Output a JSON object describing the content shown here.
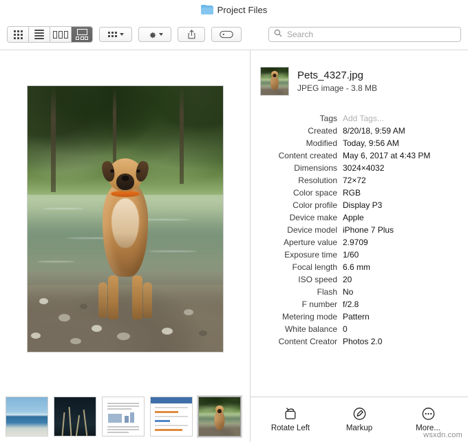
{
  "window": {
    "title": "Project Files",
    "folder_icon": "folder-icon"
  },
  "toolbar": {
    "view_modes": [
      {
        "name": "icon-view",
        "icon": "grid-icon",
        "active": false
      },
      {
        "name": "list-view",
        "icon": "list-icon",
        "active": false
      },
      {
        "name": "column-view",
        "icon": "columns-icon",
        "active": false
      },
      {
        "name": "gallery-view",
        "icon": "gallery-icon",
        "active": true
      }
    ],
    "group_by": {
      "name": "group-by-button",
      "icon": "group-icon",
      "caret": "chevron-down-icon"
    },
    "action_menu": {
      "name": "action-menu-button",
      "icon": "gear-icon",
      "caret": "chevron-down-icon"
    },
    "share": {
      "name": "share-button",
      "icon": "share-icon"
    },
    "tags": {
      "name": "tags-button",
      "icon": "tag-icon"
    },
    "search": {
      "icon": "search-icon",
      "placeholder": "Search",
      "value": ""
    }
  },
  "preview": {
    "image_alt": "dog-standing-in-river-photo"
  },
  "thumbnails": [
    {
      "name": "thumbnail-beach",
      "label": "beach photo",
      "selected": false
    },
    {
      "name": "thumbnail-night-plants",
      "label": "dark plants photo",
      "selected": false
    },
    {
      "name": "thumbnail-document",
      "label": "text document",
      "selected": false
    },
    {
      "name": "thumbnail-spreadsheet",
      "label": "spreadsheet",
      "selected": false
    },
    {
      "name": "thumbnail-dog",
      "label": "Pets_4327.jpg",
      "selected": true
    }
  ],
  "file": {
    "name": "Pets_4327.jpg",
    "kind_and_size": "JPEG image - 3.8 MB"
  },
  "info": [
    {
      "label": "Tags",
      "value": "Add Tags...",
      "placeholder": true
    },
    {
      "label": "Created",
      "value": "8/20/18, 9:59 AM",
      "placeholder": false
    },
    {
      "label": "Modified",
      "value": "Today, 9:56 AM",
      "placeholder": false
    },
    {
      "label": "Content created",
      "value": "May 6, 2017 at 4:43 PM",
      "placeholder": false
    },
    {
      "label": "Dimensions",
      "value": "3024×4032",
      "placeholder": false
    },
    {
      "label": "Resolution",
      "value": "72×72",
      "placeholder": false
    },
    {
      "label": "Color space",
      "value": "RGB",
      "placeholder": false
    },
    {
      "label": "Color profile",
      "value": "Display P3",
      "placeholder": false
    },
    {
      "label": "Device make",
      "value": "Apple",
      "placeholder": false
    },
    {
      "label": "Device model",
      "value": "iPhone 7 Plus",
      "placeholder": false
    },
    {
      "label": "Aperture value",
      "value": "2.9709",
      "placeholder": false
    },
    {
      "label": "Exposure time",
      "value": "1/60",
      "placeholder": false
    },
    {
      "label": "Focal length",
      "value": "6.6 mm",
      "placeholder": false
    },
    {
      "label": "ISO speed",
      "value": "20",
      "placeholder": false
    },
    {
      "label": "Flash",
      "value": "No",
      "placeholder": false
    },
    {
      "label": "F number",
      "value": "f/2.8",
      "placeholder": false
    },
    {
      "label": "Metering mode",
      "value": "Pattern",
      "placeholder": false
    },
    {
      "label": "White balance",
      "value": "0",
      "placeholder": false
    },
    {
      "label": "Content Creator",
      "value": "Photos 2.0",
      "placeholder": false
    }
  ],
  "actions": [
    {
      "name": "rotate-left-action",
      "label": "Rotate Left",
      "icon": "rotate-left-icon"
    },
    {
      "name": "markup-action",
      "label": "Markup",
      "icon": "markup-icon"
    },
    {
      "name": "more-action",
      "label": "More...",
      "icon": "ellipsis-circle-icon"
    }
  ],
  "watermark": {
    "text": "wsxdn.com"
  }
}
